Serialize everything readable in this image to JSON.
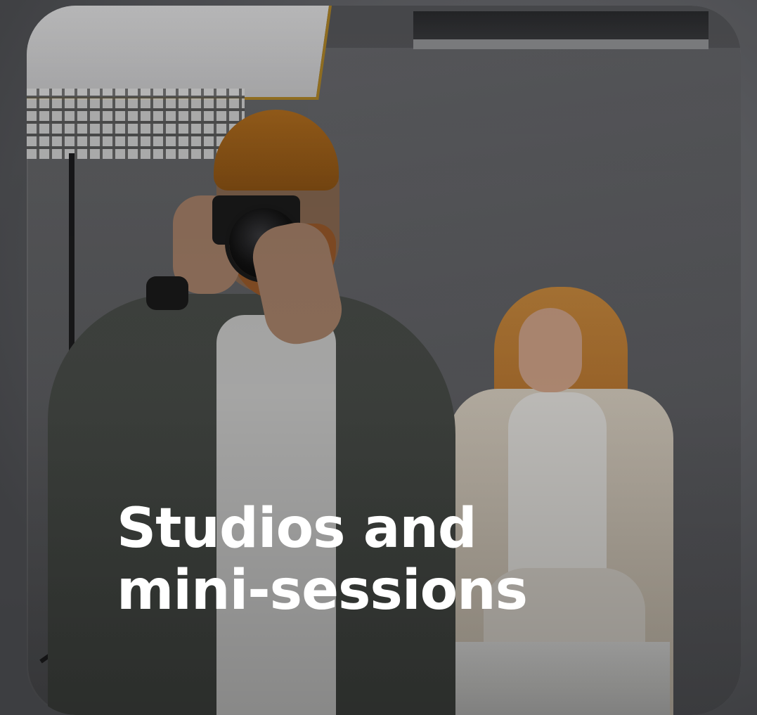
{
  "card": {
    "title_line1": "Studios and",
    "title_line2": "mini-sessions"
  },
  "colors": {
    "title_text": "#ffffff",
    "overlay": "#000000",
    "beanie_accent": "#b5701f"
  }
}
